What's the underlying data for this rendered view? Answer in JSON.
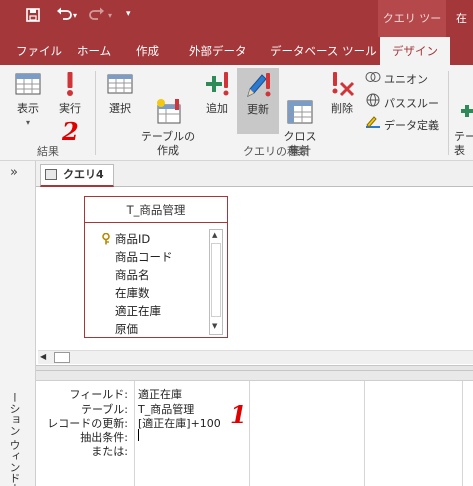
{
  "title_bar": {
    "save_icon": "save-icon",
    "undo_icon": "undo-icon",
    "redo_icon": "redo-icon",
    "qat_menu_icon": "chevron-down-icon",
    "context_tools_label": "クエリ ツール",
    "title_right": "在"
  },
  "tabs": [
    {
      "label": "ファイル"
    },
    {
      "label": "ホーム"
    },
    {
      "label": "作成"
    },
    {
      "label": "外部データ"
    },
    {
      "label": "データベース ツール"
    },
    {
      "label": "デザイン",
      "active": true
    }
  ],
  "ribbon": {
    "results_group": {
      "label": "結果",
      "view_label": "表示",
      "run_label": "実行"
    },
    "query_type_group": {
      "label": "クエリの種類",
      "select_label": "選択",
      "make_table_label": "テーブルの\n作成",
      "append_label": "追加",
      "update_label": "更新",
      "crosstab_label": "クロス\n集計",
      "delete_label": "削除",
      "union_label": "ユニオン",
      "passthrough_label": "パススルー",
      "data_definition_label": "データ定義"
    },
    "next_group_partial": "テー\n表"
  },
  "annotations": {
    "run_marker": "2",
    "grid_marker": "1"
  },
  "nav": {
    "chevron": "»",
    "label": "ーション ウィンドウ"
  },
  "document_tab": {
    "label": "クエリ4"
  },
  "table_box": {
    "title": "T_商品管理",
    "fields": [
      "商品ID",
      "商品コード",
      "商品名",
      "在庫数",
      "適正在庫",
      "原価"
    ]
  },
  "design_grid": {
    "row_labels": [
      "フィールド:",
      "テーブル:",
      "レコードの更新:",
      "抽出条件:",
      "または:"
    ],
    "column1": {
      "field": "適正在庫",
      "table": "T_商品管理",
      "update_to": "[適正在庫]+100"
    }
  },
  "colors": {
    "accent": "#a4373a",
    "ribbon_bg": "#f3f3f3",
    "annotation": "#e00000"
  }
}
